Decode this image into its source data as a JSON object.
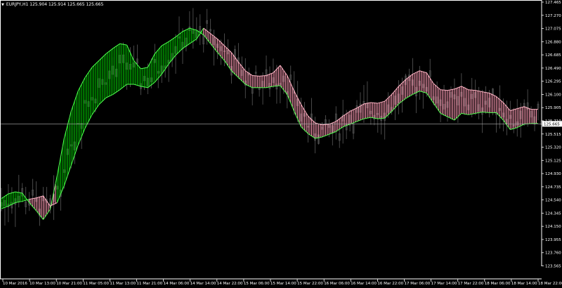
{
  "header": {
    "symbol": "EURJPY,H1",
    "ohlc": "125.904 125.914 125.665 125.665"
  },
  "colors": {
    "background": "#000000",
    "bull_fill": "#00c000",
    "bull_edge": "#50ff50",
    "bear_fill": "#ff9bb4",
    "bear_edge": "#ffb6c6",
    "candles": "#5a5a5a",
    "axis": "#ffffff",
    "current_price_line": "#b0b0b0"
  },
  "chart_data": {
    "type": "line",
    "title": "",
    "current_price": 125.665,
    "ylim": [
      123.56,
      127.465
    ],
    "y_ticks": [
      "127.465",
      "127.270",
      "127.075",
      "126.880",
      "126.685",
      "126.490",
      "126.295",
      "126.100",
      "125.905",
      "125.710",
      "125.515",
      "125.320",
      "125.125",
      "124.930",
      "124.735",
      "124.540",
      "124.345",
      "124.150",
      "123.955",
      "123.760",
      "123.565"
    ],
    "x_ticks": [
      "10 Mar 2016",
      "10 Mar 13:00",
      "10 Mar 21:00",
      "11 Mar 05:00",
      "11 Mar 13:00",
      "11 Mar 21:00",
      "14 Mar 06:00",
      "14 Mar 14:00",
      "14 Mar 22:00",
      "15 Mar 06:00",
      "15 Mar 14:00",
      "15 Mar 22:00",
      "16 Mar 06:00",
      "16 Mar 14:00",
      "16 Mar 22:00",
      "17 Mar 06:00",
      "17 Mar 14:00",
      "17 Mar 22:00",
      "18 Mar 06:00",
      "18 Mar 14:00",
      "18 Mar 22:00"
    ],
    "series": [
      {
        "values": [
          [
            124.56,
            124.41,
            "bull"
          ],
          [
            124.63,
            124.45,
            "bull"
          ],
          [
            124.66,
            124.5,
            "bull"
          ],
          [
            124.64,
            124.52,
            "bull"
          ],
          [
            124.5,
            124.55,
            "bear"
          ],
          [
            124.38,
            124.57,
            "bear"
          ],
          [
            124.25,
            124.6,
            "bear"
          ],
          [
            124.4,
            124.45,
            "bear"
          ],
          [
            124.9,
            124.5,
            "bull"
          ],
          [
            125.45,
            124.75,
            "bull"
          ],
          [
            125.85,
            125.05,
            "bull"
          ],
          [
            126.15,
            125.35,
            "bull"
          ],
          [
            126.35,
            125.6,
            "bull"
          ],
          [
            126.5,
            125.8,
            "bull"
          ],
          [
            126.6,
            125.95,
            "bull"
          ],
          [
            126.7,
            126.05,
            "bull"
          ],
          [
            126.78,
            126.1,
            "bull"
          ],
          [
            126.85,
            126.17,
            "bull"
          ],
          [
            126.83,
            126.25,
            "bull"
          ],
          [
            126.6,
            126.25,
            "bull"
          ],
          [
            126.48,
            126.22,
            "bull"
          ],
          [
            126.5,
            126.2,
            "bull"
          ],
          [
            126.7,
            126.28,
            "bull"
          ],
          [
            126.82,
            126.4,
            "bull"
          ],
          [
            126.88,
            126.55,
            "bull"
          ],
          [
            126.95,
            126.68,
            "bull"
          ],
          [
            127.03,
            126.78,
            "bull"
          ],
          [
            127.08,
            126.85,
            "bull"
          ],
          [
            127.05,
            126.92,
            "bull"
          ],
          [
            126.98,
            127.08,
            "bear"
          ],
          [
            126.85,
            127.0,
            "bear"
          ],
          [
            126.72,
            126.92,
            "bear"
          ],
          [
            126.6,
            126.82,
            "bear"
          ],
          [
            126.45,
            126.72,
            "bear"
          ],
          [
            126.35,
            126.58,
            "bear"
          ],
          [
            126.25,
            126.45,
            "bear"
          ],
          [
            126.2,
            126.38,
            "bear"
          ],
          [
            126.2,
            126.37,
            "bear"
          ],
          [
            126.2,
            126.38,
            "bear"
          ],
          [
            126.22,
            126.42,
            "bear"
          ],
          [
            126.23,
            126.53,
            "bear"
          ],
          [
            126.1,
            126.38,
            "bear"
          ],
          [
            125.85,
            126.15,
            "bear"
          ],
          [
            125.62,
            125.95,
            "bear"
          ],
          [
            125.52,
            125.78,
            "bear"
          ],
          [
            125.45,
            125.68,
            "bear"
          ],
          [
            125.47,
            125.65,
            "bear"
          ],
          [
            125.51,
            125.66,
            "bear"
          ],
          [
            125.55,
            125.7,
            "bear"
          ],
          [
            125.62,
            125.78,
            "bear"
          ],
          [
            125.66,
            125.85,
            "bear"
          ],
          [
            125.7,
            125.9,
            "bear"
          ],
          [
            125.74,
            125.96,
            "bear"
          ],
          [
            125.76,
            125.98,
            "bear"
          ],
          [
            125.74,
            125.97,
            "bear"
          ],
          [
            125.75,
            126.0,
            "bear"
          ],
          [
            125.85,
            126.1,
            "bear"
          ],
          [
            125.96,
            126.22,
            "bear"
          ],
          [
            126.04,
            126.32,
            "bear"
          ],
          [
            126.1,
            126.4,
            "bear"
          ],
          [
            126.15,
            126.45,
            "bear"
          ],
          [
            126.12,
            126.42,
            "bear"
          ],
          [
            125.97,
            126.26,
            "bear"
          ],
          [
            125.82,
            126.17,
            "bear"
          ],
          [
            125.77,
            126.16,
            "bear"
          ],
          [
            125.72,
            126.18,
            "bear"
          ],
          [
            125.82,
            126.22,
            "bear"
          ],
          [
            125.8,
            126.17,
            "bear"
          ],
          [
            125.82,
            126.16,
            "bear"
          ],
          [
            125.84,
            126.14,
            "bear"
          ],
          [
            125.83,
            126.12,
            "bear"
          ],
          [
            125.83,
            126.07,
            "bear"
          ],
          [
            125.72,
            125.98,
            "bear"
          ],
          [
            125.58,
            125.86,
            "bear"
          ],
          [
            125.61,
            125.89,
            "bear"
          ],
          [
            125.66,
            125.92,
            "bear"
          ],
          [
            125.67,
            125.88,
            "bear"
          ],
          [
            125.67,
            125.88,
            "bear"
          ]
        ]
      }
    ]
  }
}
